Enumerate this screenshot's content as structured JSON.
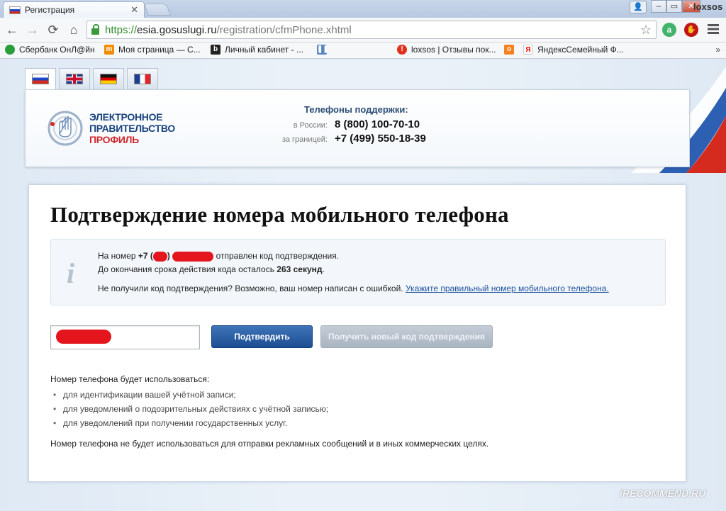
{
  "browser": {
    "tab_title": "Регистрация",
    "profile_name": "loxsos",
    "url_scheme": "https://",
    "url_host": "esia.gosuslugi.ru",
    "url_path": "/registration/cfmPhone.xhtml",
    "bookmarks": [
      {
        "label": "Сбербанк ОнЛ@йн",
        "icon": "sberbank-icon",
        "color": "#2a9e3a"
      },
      {
        "label": "Моя страница — С...",
        "icon": "moi-mir-icon",
        "color": "#f08c00"
      },
      {
        "label": "Личный кабинет - ...",
        "icon": "beeline-icon",
        "color": "#222222"
      },
      {
        "label": "",
        "icon": "pause-icon",
        "color": "#5a86c2"
      },
      {
        "label": "loxsos | Отзывы пок...",
        "icon": "irecommend-icon",
        "color": "#e0311d"
      },
      {
        "label": "",
        "icon": "odnoklassniki-icon",
        "color": "#f58220"
      },
      {
        "label": "ЯндексСемейный Ф...",
        "icon": "yandex-icon",
        "color": "#ffffff"
      }
    ]
  },
  "header": {
    "logo_line1": "ЭЛЕКТРОННОЕ",
    "logo_line2": "ПРАВИТЕЛЬСТВО",
    "logo_line3": "ПРОФИЛЬ",
    "support_title": "Телефоны поддержки:",
    "russia_label": "в России:",
    "russia_number": "8 (800) 100-70-10",
    "abroad_label": "за границей:",
    "abroad_number": "+7 (499) 550-18-39"
  },
  "main": {
    "title": "Подтверждение номера мобильного телефона",
    "info": {
      "line1_prefix": "На номер ",
      "line1_code": "+7 (",
      "line1_close": ")",
      "line1_suffix": " отправлен код подтверждения.",
      "line2_prefix": "До окончания срока действия кода осталось ",
      "line2_time": "263 секунд",
      "line2_suffix": ".",
      "line3_text": "Не получили код подтверждения? Возможно, ваш номер написан с ошибкой. ",
      "line3_link": "Укажите правильный номер мобильного телефона."
    },
    "confirm_button": "Подтвердить",
    "new_code_button": "Получить новый код подтверждения",
    "usage_title": "Номер телефона будет использоваться:",
    "usage_items": [
      "для идентификации вашей учётной записи;",
      "для уведомлений о подозрительных действиях с учётной записью;",
      "для уведомлений при получении государственных услуг."
    ],
    "note": "Номер телефона не будет использоваться для отправки рекламных сообщений и в иных коммерческих целях."
  },
  "watermark": "iRECOMMEND.RU"
}
